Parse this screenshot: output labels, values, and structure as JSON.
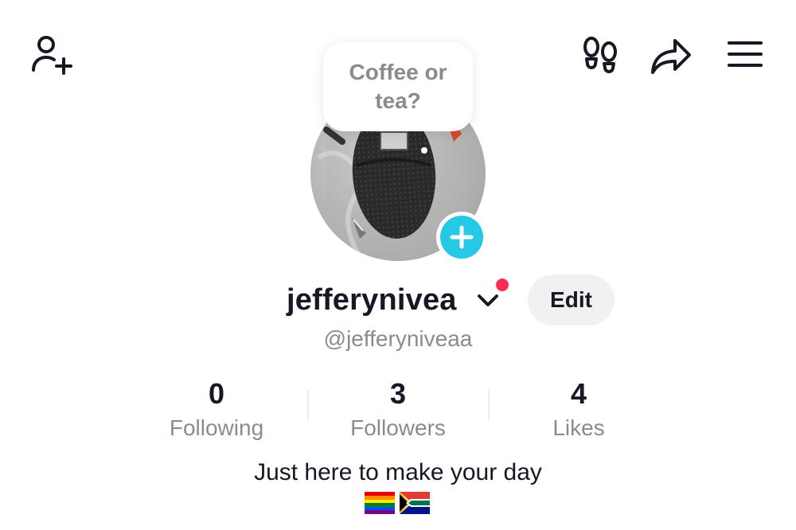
{
  "header": {
    "add_friend_icon": "person-plus-icon",
    "footprints_icon": "footprints-icon",
    "share_icon": "share-arrow-icon",
    "menu_icon": "hamburger-menu-icon"
  },
  "note": {
    "text": "Coffee or tea?"
  },
  "profile": {
    "username": "jefferynivea",
    "handle": "@jefferyniveaa",
    "edit_label": "Edit",
    "bio": "Just here to make your day",
    "bio_emojis": [
      "rainbow-flag",
      "south-africa-flag"
    ]
  },
  "stats": [
    {
      "value": "0",
      "label": "Following"
    },
    {
      "value": "3",
      "label": "Followers"
    },
    {
      "value": "4",
      "label": "Likes"
    }
  ],
  "colors": {
    "accent_cyan": "#25c9e6",
    "notification_red": "#fe2c55",
    "text_primary": "#161823",
    "text_secondary": "#8a8b91"
  }
}
